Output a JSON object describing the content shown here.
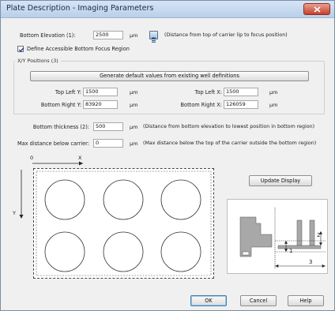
{
  "window": {
    "title": "Plate Description - Imaging Parameters"
  },
  "bottom_elevation": {
    "label": "Bottom Elevation (1):",
    "value": "2500",
    "unit": "µm",
    "description": "(Distance from top of carrier lip to focus position)"
  },
  "define_region": {
    "label": "Define Accessible Bottom Focus Region",
    "checked": true
  },
  "xy_positions": {
    "legend": "X/Y Positions (3)",
    "generate_button": "Generate default values from existing well definitions",
    "top_left_y": {
      "label": "Top Left Y:",
      "value": "1500",
      "unit": "µm"
    },
    "top_left_x": {
      "label": "Top Left X:",
      "value": "1500",
      "unit": "µm"
    },
    "bottom_right_y": {
      "label": "Bottom Right Y:",
      "value": "83920",
      "unit": "µm"
    },
    "bottom_right_x": {
      "label": "Bottom Right X:",
      "value": "126059",
      "unit": "µm"
    }
  },
  "bottom_thickness": {
    "label": "Bottom thickness (2):",
    "value": "500",
    "unit": "µm",
    "description": "(Distance from bottom elevation to lowest position in bottom region)"
  },
  "max_distance": {
    "label": "Max distance below carrier:",
    "value": "0",
    "unit": "µm",
    "description": "(Max distance below the top of the carrier outside the bottom region)"
  },
  "axes": {
    "origin": "0",
    "x": "X",
    "y": "Y"
  },
  "update_button": "Update Display",
  "diagram_labels": {
    "one": "1",
    "two": "2",
    "three": "3"
  },
  "footer": {
    "ok": "OK",
    "cancel": "Cancel",
    "help": "Help"
  },
  "colors": {
    "titlebar": "#c7d8ee",
    "close": "#c7402c",
    "diagram_fill": "#a8a8a8"
  }
}
